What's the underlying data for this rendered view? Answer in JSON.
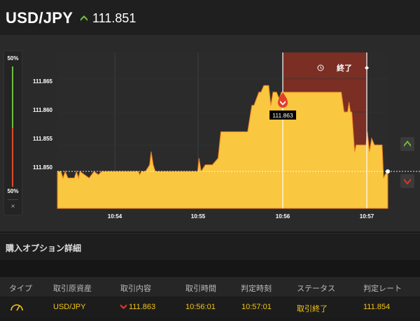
{
  "header": {
    "pair": "USD/JPY",
    "price": "111.851",
    "trend_icon": "up-arrow-icon"
  },
  "sentiment": {
    "top_label": "50%",
    "bottom_label": "50%",
    "close_label": "×",
    "up_ratio": 0.5
  },
  "chart": {
    "y_ticks": [
      "111.865",
      "111.860",
      "111.855",
      "111.850"
    ],
    "x_ticks": [
      "10:54",
      "10:55",
      "10:56",
      "10:57"
    ],
    "entry_label": "111.863",
    "end_label": "終了",
    "current_level": 111.851,
    "colors": {
      "area": "#f9c740",
      "area_edge": "#e87a1e",
      "expired": "#7a2e24",
      "up": "#6fbf3c",
      "down": "#d9392a"
    }
  },
  "chart_data": {
    "type": "area",
    "title": "",
    "xlabel": "",
    "ylabel": "",
    "x_ticks": [
      "10:54",
      "10:55",
      "10:56",
      "10:57"
    ],
    "ylim": [
      111.8454,
      111.869
    ],
    "entry_rate": 111.863,
    "series": [
      {
        "values": [
          [
            0,
            111.851
          ],
          [
            5,
            111.851
          ],
          [
            8,
            111.85
          ],
          [
            11,
            111.851
          ],
          [
            15,
            111.85
          ],
          [
            24,
            111.85
          ],
          [
            27,
            111.851
          ],
          [
            30,
            111.85
          ],
          [
            32,
            111.851
          ],
          [
            45,
            111.85
          ],
          [
            52,
            111.851
          ],
          [
            58,
            111.8505
          ],
          [
            63,
            111.851
          ],
          [
            72,
            111.851
          ],
          [
            80,
            111.851
          ],
          [
            90,
            111.851
          ],
          [
            100,
            111.851
          ],
          [
            110,
            111.851
          ],
          [
            115,
            111.851
          ],
          [
            117,
            111.8505
          ],
          [
            119,
            111.851
          ],
          [
            125,
            111.851
          ],
          [
            131,
            111.852
          ],
          [
            133,
            111.854
          ],
          [
            136,
            111.852
          ],
          [
            139,
            111.851
          ],
          [
            150,
            111.851
          ],
          [
            160,
            111.851
          ],
          [
            170,
            111.851
          ],
          [
            180,
            111.851
          ],
          [
            190,
            111.851
          ],
          [
            199,
            111.851
          ],
          [
            201,
            111.853
          ],
          [
            204,
            111.851
          ],
          [
            210,
            111.852
          ],
          [
            220,
            111.852
          ],
          [
            228,
            111.853
          ],
          [
            232,
            111.857
          ],
          [
            238,
            111.857
          ],
          [
            250,
            111.857
          ],
          [
            262,
            111.857
          ],
          [
            270,
            111.857
          ],
          [
            276,
            111.861
          ],
          [
            279,
            111.861
          ],
          [
            286,
            111.863
          ],
          [
            289,
            111.863
          ],
          [
            293,
            111.864
          ],
          [
            300,
            111.864
          ],
          [
            303,
            111.861
          ],
          [
            306,
            111.863
          ],
          [
            311,
            111.863
          ],
          [
            315,
            111.862
          ],
          [
            318,
            111.863
          ],
          [
            330,
            111.863
          ],
          [
            350,
            111.863
          ],
          [
            375,
            111.863
          ],
          [
            380,
            111.863
          ],
          [
            403,
            111.863
          ],
          [
            407,
            111.86
          ],
          [
            412,
            111.86
          ],
          [
            414,
            111.8615
          ],
          [
            416,
            111.86
          ],
          [
            418,
            111.86
          ],
          [
            420,
            111.857
          ],
          [
            422,
            111.854
          ],
          [
            424,
            111.855
          ],
          [
            438,
            111.855
          ],
          [
            440,
            111.857
          ],
          [
            443,
            111.854
          ],
          [
            446,
            111.856
          ],
          [
            450,
            111.855
          ],
          [
            455,
            111.855
          ],
          [
            461,
            111.855
          ],
          [
            463,
            111.85
          ],
          [
            465,
            111.8505
          ],
          [
            469,
            111.851
          ]
        ]
      }
    ]
  },
  "details": {
    "title": "購入オプション詳細",
    "columns": [
      "タイプ",
      "取引原資産",
      "取引内容",
      "取引時間",
      "判定時刻",
      "ステータス",
      "判定レート"
    ],
    "row": {
      "type_icon": "gauge-icon",
      "asset": "USD/JPY",
      "content_icon": "down-arrow-icon",
      "content": "111.863",
      "trade_time": "10:56:01",
      "judge_time": "10:57:01",
      "status": "取引終了",
      "judge_rate": "111.854"
    }
  }
}
